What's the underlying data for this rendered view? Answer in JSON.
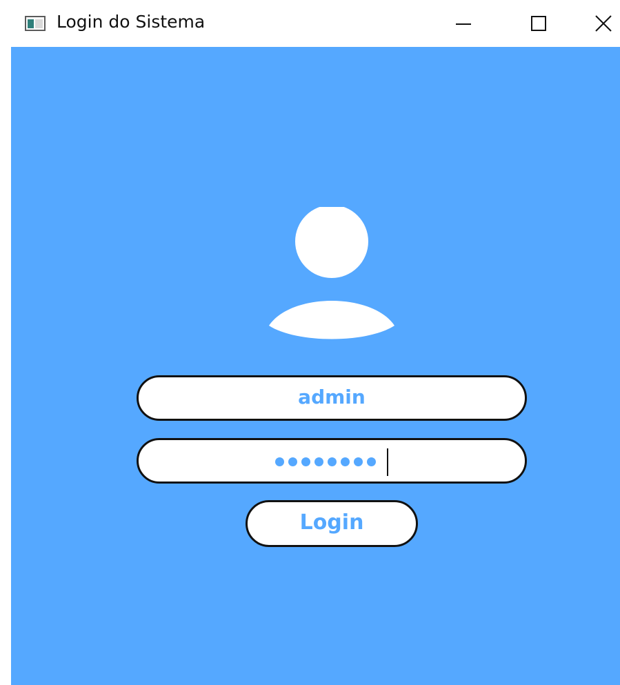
{
  "window": {
    "title": "Login do Sistema",
    "icon": "app-window-icon",
    "controls": [
      "minimize-icon",
      "maximize-icon",
      "close-icon"
    ]
  },
  "colors": {
    "background": "#55a8ff",
    "field_background": "#ffffff",
    "accent_text": "#55a8ff",
    "border": "#111111"
  },
  "avatar": {
    "icon": "user-icon"
  },
  "form": {
    "username_value": "admin",
    "password_length": 8,
    "login_label": "Login"
  }
}
